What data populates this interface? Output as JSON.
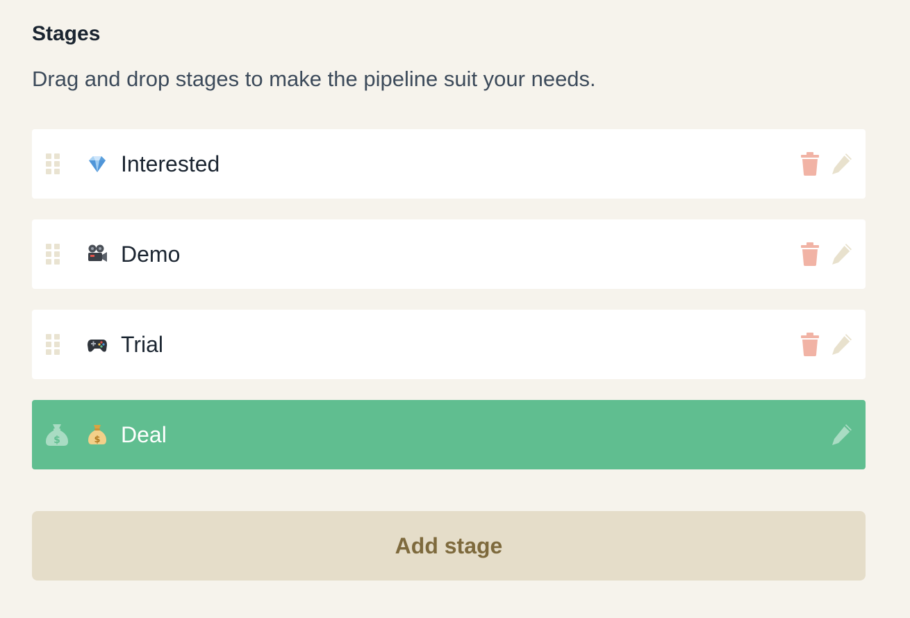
{
  "header": {
    "title": "Stages",
    "subtitle": "Drag and drop stages to make the pipeline suit your needs."
  },
  "stages": [
    {
      "name": "Interested",
      "emoji": "gem-icon",
      "won": false
    },
    {
      "name": "Demo",
      "emoji": "movie-camera-icon",
      "won": false
    },
    {
      "name": "Trial",
      "emoji": "game-controller-icon",
      "won": false
    },
    {
      "name": "Deal",
      "emoji": "money-bag-icon",
      "won": true
    }
  ],
  "actions": {
    "add_stage_label": "Add stage"
  },
  "colors": {
    "background": "#f6f3ec",
    "won_stage": "#60be90",
    "delete_icon": "#f1b3a5",
    "edit_icon": "#e8e1cd",
    "add_button": "#e5ddc9",
    "add_button_text": "#7e6a3d"
  }
}
